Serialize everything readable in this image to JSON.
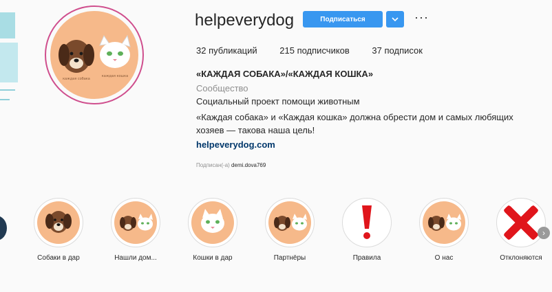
{
  "profile": {
    "username": "helpeverydog",
    "follow_label": "Подписаться",
    "more_label": "···",
    "stats": {
      "posts": "32 публикаций",
      "followers": "215 подписчиков",
      "following": "37 подписок"
    },
    "full_name": "«КАЖДАЯ СОБАКА»/«КАЖДАЯ КОШКА»",
    "category": "Сообщество",
    "bio_line1": "Социальный проект помощи животным",
    "bio_line2": "«Каждая собака» и «Каждая кошка» должна обрести дом и самых любящих",
    "bio_line3": "хозяев — такова наша цель!",
    "link": "helpeverydog.com",
    "followed_by_prefix": "Подписан(-а)",
    "followed_by_user": "demi.dova769"
  },
  "highlights": [
    {
      "label": "Собаки в дар",
      "icon": "dog-icon"
    },
    {
      "label": "Нашли дом...",
      "icon": "dog-and-cat-icon"
    },
    {
      "label": "Кошки в дар",
      "icon": "cat-icon"
    },
    {
      "label": "Партнёры",
      "icon": "dog-and-cat-icon"
    },
    {
      "label": "Правила",
      "icon": "exclamation-icon"
    },
    {
      "label": "О нас",
      "icon": "dog-and-cat-icon"
    },
    {
      "label": "Отклоняются",
      "icon": "red-cross-icon"
    }
  ],
  "colors": {
    "accent": "#3897f0",
    "avatar_bg": "#f6b98a",
    "link": "#00376b",
    "story_ring": "#cf4e8d"
  }
}
